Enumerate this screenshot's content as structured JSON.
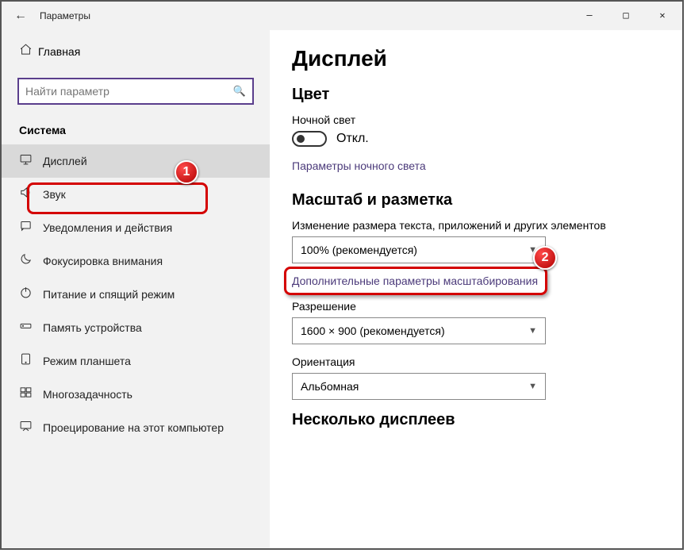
{
  "titlebar": {
    "title": "Параметры"
  },
  "sidebar": {
    "home": "Главная",
    "search_placeholder": "Найти параметр",
    "category": "Система",
    "items": [
      {
        "label": "Дисплей",
        "icon": "display-icon"
      },
      {
        "label": "Звук",
        "icon": "sound-icon"
      },
      {
        "label": "Уведомления и действия",
        "icon": "notifications-icon"
      },
      {
        "label": "Фокусировка внимания",
        "icon": "focus-icon"
      },
      {
        "label": "Питание и спящий режим",
        "icon": "power-icon"
      },
      {
        "label": "Память устройства",
        "icon": "storage-icon"
      },
      {
        "label": "Режим планшета",
        "icon": "tablet-icon"
      },
      {
        "label": "Многозадачность",
        "icon": "multitasking-icon"
      },
      {
        "label": "Проецирование на этот компьютер",
        "icon": "projecting-icon"
      }
    ]
  },
  "content": {
    "heading": "Дисплей",
    "color_section": "Цвет",
    "night_light_label": "Ночной свет",
    "toggle_state": "Откл.",
    "night_light_link": "Параметры ночного света",
    "scale_section": "Масштаб и разметка",
    "scale_label": "Изменение размера текста, приложений и других элементов",
    "scale_value": "100% (рекомендуется)",
    "advanced_scaling": "Дополнительные параметры масштабирования",
    "resolution_label": "Разрешение",
    "resolution_value": "1600 × 900 (рекомендуется)",
    "orientation_label": "Ориентация",
    "orientation_value": "Альбомная",
    "multi_section": "Несколько дисплеев"
  },
  "annotations": {
    "b1": "1",
    "b2": "2"
  }
}
